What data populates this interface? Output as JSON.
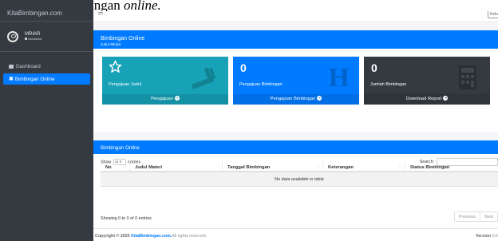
{
  "caption": {
    "prefix": "ngajuan bimbingan",
    "emph": "online."
  },
  "brand": {
    "name": "KitaBimbingan.com"
  },
  "user": {
    "name": "MRIAR",
    "role": "Mahasiswa"
  },
  "sidebar": {
    "items": [
      {
        "label": "Dashboard",
        "active": false
      },
      {
        "label": "Bimbingan Online",
        "active": true
      }
    ]
  },
  "topbar": {
    "logout_label": "Keluar"
  },
  "card": {
    "title": "Bimbingan Online",
    "subtitle": "Judul Skripsi"
  },
  "boxes": [
    {
      "number": "",
      "label": "Pengajuan Judul",
      "footer": "Pengajuan",
      "icon": "star-icon"
    },
    {
      "number": "0",
      "label": "Pengajuan Bimbingan",
      "footer": "Pengajuan Bimbingan",
      "icon": "h-icon"
    },
    {
      "number": "0",
      "label": "Jumlah Bimbingan",
      "footer": "Download Report",
      "icon": "calculator-icon"
    }
  ],
  "table_card": {
    "title": "Bimbingan Online",
    "show_label": "Show",
    "entries_value": "10",
    "entries_label": "entries",
    "search_label": "Search:",
    "search_value": "",
    "columns": [
      "No",
      "Judul Materi",
      "Tanggal Bimbingan",
      "Keterangan",
      "Status Bimbingan"
    ],
    "empty_text": "No data available in table",
    "info": "Showing 0 to 0 of 0 entries",
    "prev_label": "Previous",
    "next_label": "Next"
  },
  "footer": {
    "copyright_prefix": "Copyright © 2020",
    "copyright_link": "KitaBimbingan.com.",
    "copyright_suffix": "All rights reserved.",
    "version_label": "Version",
    "version_value": "0.0"
  },
  "colors": {
    "primary": "#007bff",
    "info": "#17a2b8",
    "dark": "#343a40",
    "sidebar": "#343a40"
  }
}
